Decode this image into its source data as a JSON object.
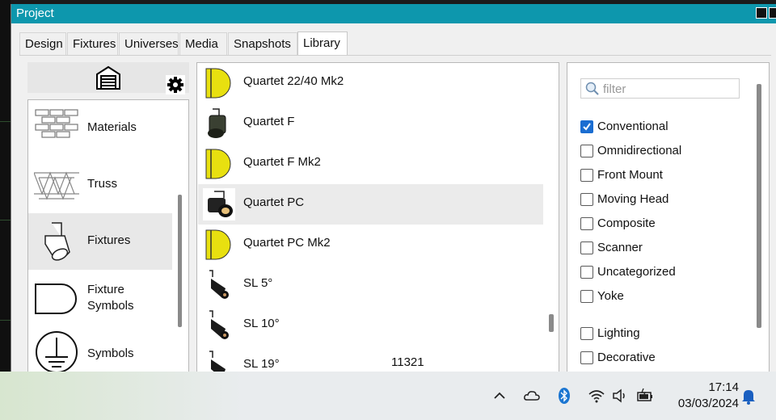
{
  "window": {
    "title": "Project"
  },
  "tabs": [
    {
      "label": "Design",
      "active": false
    },
    {
      "label": "Fixtures",
      "active": false
    },
    {
      "label": "Universes",
      "active": false
    },
    {
      "label": "Media",
      "active": false
    },
    {
      "label": "Snapshots",
      "active": false
    },
    {
      "label": "Library",
      "active": true
    }
  ],
  "categories": [
    {
      "label": "Materials",
      "icon": "brick-wall-icon"
    },
    {
      "label": "Truss",
      "icon": "truss-icon"
    },
    {
      "label": "Fixtures",
      "icon": "fixture-icon",
      "selected": true
    },
    {
      "label": "Fixture\nSymbols",
      "icon": "fixture-symbol-icon"
    },
    {
      "label": "Symbols",
      "icon": "ground-symbol-icon"
    }
  ],
  "fixtures": [
    {
      "name": "Quartet 22/40 Mk2",
      "icon": "yellow-symbol-icon"
    },
    {
      "name": "Quartet F",
      "icon": "fresnel-photo-icon"
    },
    {
      "name": "Quartet F Mk2",
      "icon": "yellow-symbol-icon"
    },
    {
      "name": "Quartet PC",
      "icon": "pc-photo-icon",
      "selected": true
    },
    {
      "name": "Quartet PC Mk2",
      "icon": "yellow-symbol-icon"
    },
    {
      "name": "SL 5°",
      "icon": "profile-photo-icon"
    },
    {
      "name": "SL 10°",
      "icon": "profile-photo-icon"
    },
    {
      "name": "SL 19°",
      "icon": "profile-photo-icon"
    }
  ],
  "extra_value": "11321",
  "filter": {
    "placeholder": "filter"
  },
  "filters": [
    {
      "label": "Conventional",
      "checked": true
    },
    {
      "label": "Omnidirectional",
      "checked": false
    },
    {
      "label": "Front Mount",
      "checked": false
    },
    {
      "label": "Moving Head",
      "checked": false
    },
    {
      "label": "Composite",
      "checked": false
    },
    {
      "label": "Scanner",
      "checked": false
    },
    {
      "label": "Uncategorized",
      "checked": false
    },
    {
      "label": "Yoke",
      "checked": false
    },
    {
      "label": "Lighting",
      "checked": false
    },
    {
      "label": "Decorative",
      "checked": false
    }
  ],
  "taskbar": {
    "time": "17:14",
    "date": "03/03/2024"
  },
  "colors": {
    "titlebar": "#0d97ad",
    "accent": "#1a6dd1",
    "symbol_yellow": "#e8e010"
  }
}
